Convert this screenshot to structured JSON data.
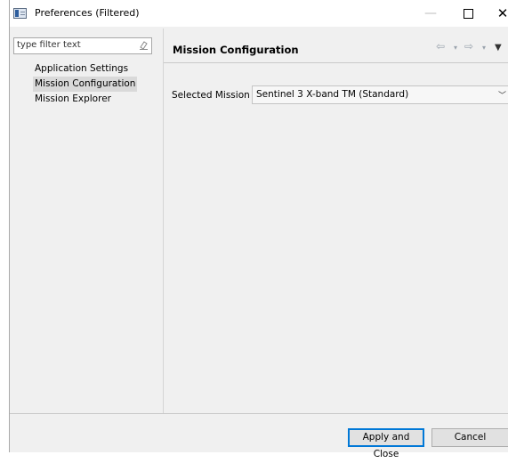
{
  "window": {
    "title": "Preferences (Filtered)",
    "controls": {
      "minimize": "—",
      "maximize": "□",
      "close": "✕"
    }
  },
  "filter": {
    "placeholder": "type filter text",
    "icon": "eraser-icon"
  },
  "tree": {
    "items": [
      {
        "label": "Application Settings",
        "selected": false
      },
      {
        "label": "Mission Configuration",
        "selected": true
      },
      {
        "label": "Mission Explorer",
        "selected": false
      }
    ]
  },
  "page": {
    "title": "Mission Configuration",
    "nav": {
      "back_icon": "⇦",
      "forward_icon": "⇨",
      "dropdown_icon": "▾",
      "menu_icon": "▼"
    }
  },
  "mission": {
    "label": "Selected Mission",
    "value": "Sentinel 3 X-band TM (Standard)",
    "arrow": "﹀"
  },
  "buttons": {
    "apply_close": "Apply and Close",
    "cancel": "Cancel"
  },
  "colors": {
    "accent": "#0078d7",
    "selection": "#d9d9d9",
    "background": "#f0f0f0"
  }
}
